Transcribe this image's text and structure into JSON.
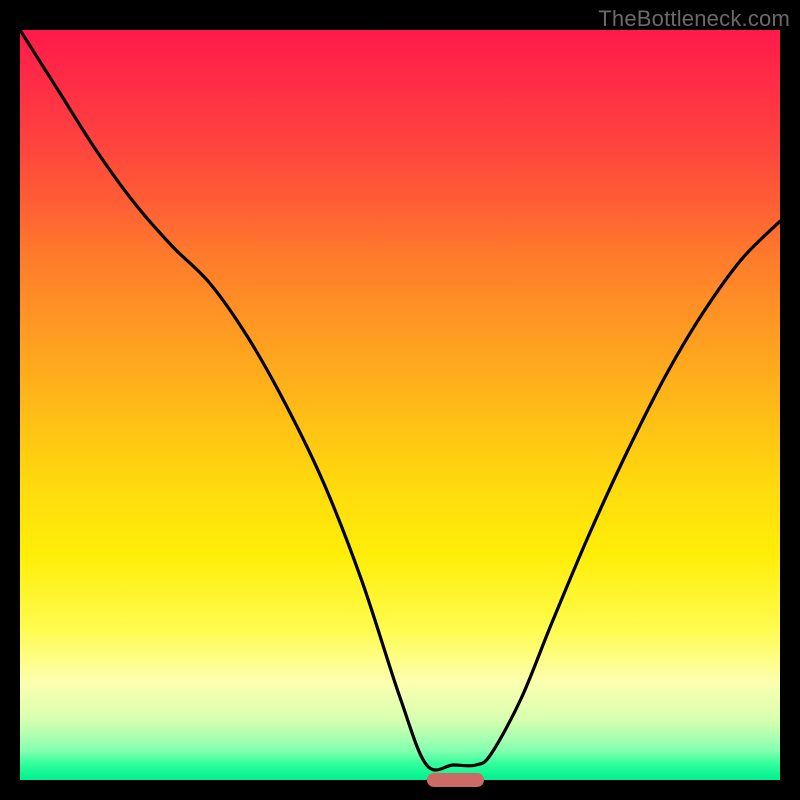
{
  "watermark": "TheBottleneck.com",
  "colors": {
    "frame_bg": "#000000",
    "marker": "#cc6b66",
    "curve": "#000000",
    "gradient_top": "#ff1a4b",
    "gradient_bottom": "#00f090"
  },
  "marker": {
    "x_frac": 0.535,
    "width_frac": 0.075
  },
  "chart_data": {
    "type": "line",
    "title": "",
    "xlabel": "",
    "ylabel": "",
    "xlim": [
      0,
      1
    ],
    "ylim": [
      0,
      1
    ],
    "legend": false,
    "grid": false,
    "annotations": [
      "TheBottleneck.com"
    ],
    "series": [
      {
        "name": "curve",
        "x": [
          0.0,
          0.05,
          0.1,
          0.15,
          0.2,
          0.25,
          0.3,
          0.35,
          0.4,
          0.45,
          0.5,
          0.535,
          0.57,
          0.6,
          0.62,
          0.66,
          0.7,
          0.75,
          0.8,
          0.85,
          0.9,
          0.95,
          1.0
        ],
        "y": [
          1.0,
          0.92,
          0.84,
          0.77,
          0.712,
          0.662,
          0.59,
          0.5,
          0.395,
          0.265,
          0.11,
          0.02,
          0.02,
          0.02,
          0.035,
          0.11,
          0.21,
          0.33,
          0.44,
          0.54,
          0.625,
          0.695,
          0.745
        ]
      }
    ],
    "optimum_marker": {
      "x_start": 0.535,
      "x_end": 0.61,
      "y": 0.0
    }
  }
}
